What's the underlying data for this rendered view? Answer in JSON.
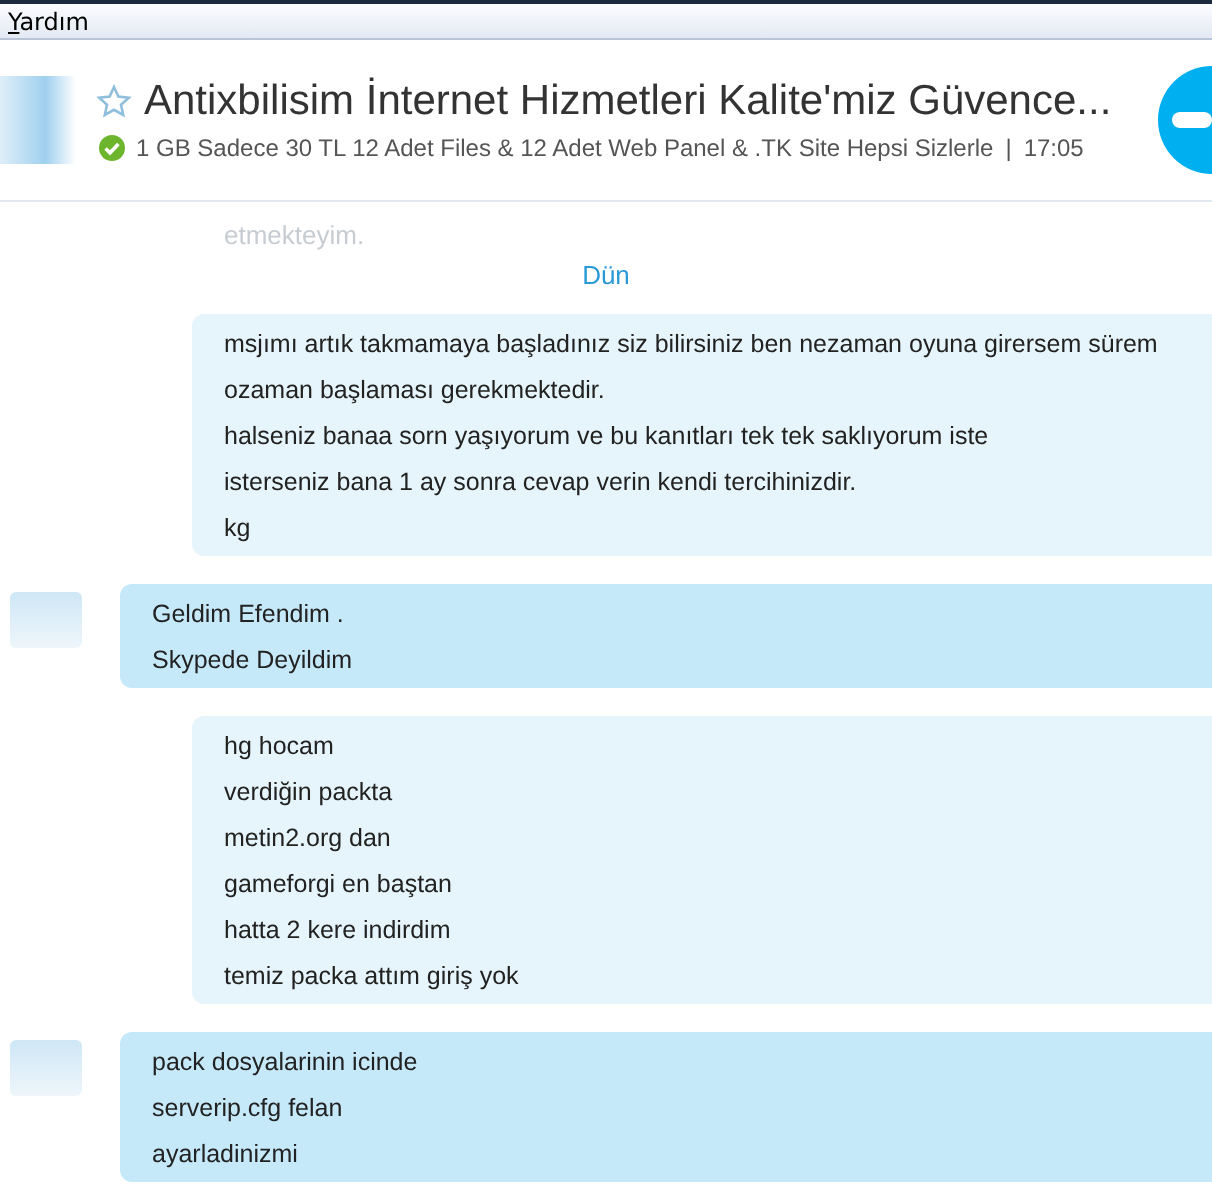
{
  "menu": [
    {
      "label": "Yardım"
    }
  ],
  "header": {
    "title": "Antixbilisim İnternet Hizmetleri Kalite'miz Güvence...",
    "favorite": false,
    "online": true,
    "mood": "1 GB Sadece 30 TL  12 Adet Files & 12 Adet Web Panel & .TK Site Hepsi Sizlerle",
    "separator": "|",
    "time": "17:05"
  },
  "chat": [
    {
      "kind": "faded",
      "lines": [
        "etmekteyim."
      ]
    },
    {
      "kind": "date",
      "text": "Dün"
    },
    {
      "kind": "outgoing",
      "lines": [
        "msjımı artık takmamaya başladınız siz bilirsiniz ben nezaman oyuna girersem sürem ozaman başlaması gerekmektedir.",
        "halseniz banaa sorn yaşıyorum ve bu kanıtları tek tek saklıyorum iste",
        "isterseniz bana 1 ay sonra cevap verin kendi tercihinizdir.",
        "kg"
      ]
    },
    {
      "kind": "incoming",
      "lines": [
        "Geldim Efendim .",
        "Skypede Deyildim"
      ]
    },
    {
      "kind": "outgoing",
      "lines": [
        "hg hocam",
        "verdiğin packta",
        "metin2.org dan",
        "gameforgi en baştan",
        "hatta 2 kere indirdim",
        "temiz packa attım giriş yok"
      ]
    },
    {
      "kind": "incoming",
      "lines": [
        "pack dosyalarinin icinde",
        "serverip.cfg felan",
        "ayarladinizmi"
      ]
    }
  ]
}
